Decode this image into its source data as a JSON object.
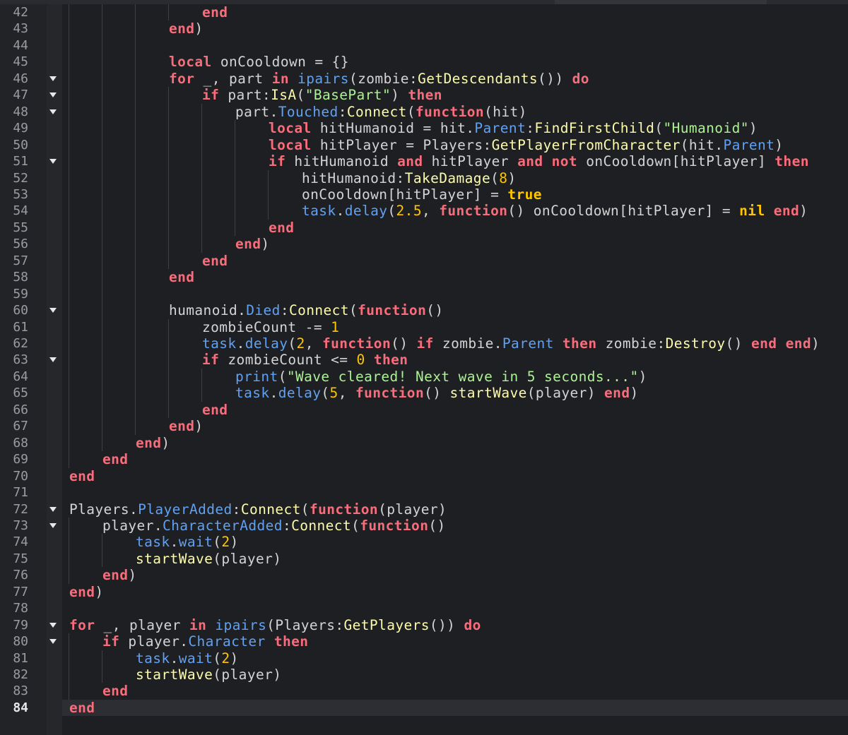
{
  "editor": {
    "current_line": 84,
    "colors": {
      "background": "#1e1f22",
      "keyword": "#f86d7c",
      "function": "#fdfbac",
      "property": "#61a1f1",
      "string": "#adf195",
      "number": "#ffc600",
      "identifier": "#d4d4d4",
      "line_number": "#9a9ca3"
    },
    "lines": [
      {
        "n": "42",
        "indent": 4,
        "fold": false,
        "tokens": [
          [
            "kw",
            "end"
          ]
        ]
      },
      {
        "n": "43",
        "indent": 3,
        "fold": false,
        "tokens": [
          [
            "kw",
            "end"
          ],
          [
            "op",
            ")"
          ]
        ]
      },
      {
        "n": "44",
        "indent": 0,
        "fold": false,
        "tokens": []
      },
      {
        "n": "45",
        "indent": 3,
        "fold": false,
        "tokens": [
          [
            "kw",
            "local"
          ],
          [
            "id",
            " onCooldown "
          ],
          [
            "op",
            "= {}"
          ]
        ]
      },
      {
        "n": "46",
        "indent": 3,
        "fold": true,
        "tokens": [
          [
            "kw",
            "for"
          ],
          [
            "id",
            " _, part "
          ],
          [
            "kw",
            "in"
          ],
          [
            "id",
            " "
          ],
          [
            "prop",
            "ipairs"
          ],
          [
            "op",
            "("
          ],
          [
            "id",
            "zombie"
          ],
          [
            "op",
            ":"
          ],
          [
            "fn",
            "GetDescendants"
          ],
          [
            "op",
            "()) "
          ],
          [
            "kw",
            "do"
          ]
        ]
      },
      {
        "n": "47",
        "indent": 4,
        "fold": true,
        "tokens": [
          [
            "kw",
            "if"
          ],
          [
            "id",
            " part"
          ],
          [
            "op",
            ":"
          ],
          [
            "fn",
            "IsA"
          ],
          [
            "op",
            "("
          ],
          [
            "str",
            "\"BasePart\""
          ],
          [
            "op",
            ") "
          ],
          [
            "kw",
            "then"
          ]
        ]
      },
      {
        "n": "48",
        "indent": 5,
        "fold": true,
        "tokens": [
          [
            "id",
            "part"
          ],
          [
            "op",
            "."
          ],
          [
            "prop",
            "Touched"
          ],
          [
            "op",
            ":"
          ],
          [
            "fn",
            "Connect"
          ],
          [
            "op",
            "("
          ],
          [
            "kw",
            "function"
          ],
          [
            "op",
            "("
          ],
          [
            "id",
            "hit"
          ],
          [
            "op",
            ")"
          ]
        ]
      },
      {
        "n": "49",
        "indent": 6,
        "fold": false,
        "tokens": [
          [
            "kw",
            "local"
          ],
          [
            "id",
            " hitHumanoid "
          ],
          [
            "op",
            "= "
          ],
          [
            "id",
            "hit"
          ],
          [
            "op",
            "."
          ],
          [
            "prop",
            "Parent"
          ],
          [
            "op",
            ":"
          ],
          [
            "fn",
            "FindFirstChild"
          ],
          [
            "op",
            "("
          ],
          [
            "str",
            "\"Humanoid\""
          ],
          [
            "op",
            ")"
          ]
        ]
      },
      {
        "n": "50",
        "indent": 6,
        "fold": false,
        "tokens": [
          [
            "kw",
            "local"
          ],
          [
            "id",
            " hitPlayer "
          ],
          [
            "op",
            "= "
          ],
          [
            "id",
            "Players"
          ],
          [
            "op",
            ":"
          ],
          [
            "fn",
            "GetPlayerFromCharacter"
          ],
          [
            "op",
            "("
          ],
          [
            "id",
            "hit"
          ],
          [
            "op",
            "."
          ],
          [
            "prop",
            "Parent"
          ],
          [
            "op",
            ")"
          ]
        ]
      },
      {
        "n": "51",
        "indent": 6,
        "fold": true,
        "tokens": [
          [
            "kw",
            "if"
          ],
          [
            "id",
            " hitHumanoid "
          ],
          [
            "kw",
            "and"
          ],
          [
            "id",
            " hitPlayer "
          ],
          [
            "kw",
            "and"
          ],
          [
            "id",
            " "
          ],
          [
            "kw",
            "not"
          ],
          [
            "id",
            " onCooldown[hitPlayer] "
          ],
          [
            "kw",
            "then"
          ]
        ]
      },
      {
        "n": "52",
        "indent": 7,
        "fold": false,
        "tokens": [
          [
            "id",
            "hitHumanoid"
          ],
          [
            "op",
            ":"
          ],
          [
            "fn",
            "TakeDamage"
          ],
          [
            "op",
            "("
          ],
          [
            "num",
            "8"
          ],
          [
            "op",
            ")"
          ]
        ]
      },
      {
        "n": "53",
        "indent": 7,
        "fold": false,
        "tokens": [
          [
            "id",
            "onCooldown[hitPlayer] "
          ],
          [
            "op",
            "= "
          ],
          [
            "bool",
            "true"
          ]
        ]
      },
      {
        "n": "54",
        "indent": 7,
        "fold": false,
        "tokens": [
          [
            "prop",
            "task"
          ],
          [
            "op",
            "."
          ],
          [
            "prop",
            "delay"
          ],
          [
            "op",
            "("
          ],
          [
            "num",
            "2.5"
          ],
          [
            "op",
            ", "
          ],
          [
            "kw",
            "function"
          ],
          [
            "op",
            "() "
          ],
          [
            "id",
            "onCooldown[hitPlayer] "
          ],
          [
            "op",
            "= "
          ],
          [
            "bool",
            "nil"
          ],
          [
            "id",
            " "
          ],
          [
            "kw",
            "end"
          ],
          [
            "op",
            ")"
          ]
        ]
      },
      {
        "n": "55",
        "indent": 6,
        "fold": false,
        "tokens": [
          [
            "kw",
            "end"
          ]
        ]
      },
      {
        "n": "56",
        "indent": 5,
        "fold": false,
        "tokens": [
          [
            "kw",
            "end"
          ],
          [
            "op",
            ")"
          ]
        ]
      },
      {
        "n": "57",
        "indent": 4,
        "fold": false,
        "tokens": [
          [
            "kw",
            "end"
          ]
        ]
      },
      {
        "n": "58",
        "indent": 3,
        "fold": false,
        "tokens": [
          [
            "kw",
            "end"
          ]
        ]
      },
      {
        "n": "59",
        "indent": 0,
        "fold": false,
        "tokens": []
      },
      {
        "n": "60",
        "indent": 3,
        "fold": true,
        "tokens": [
          [
            "id",
            "humanoid"
          ],
          [
            "op",
            "."
          ],
          [
            "prop",
            "Died"
          ],
          [
            "op",
            ":"
          ],
          [
            "fn",
            "Connect"
          ],
          [
            "op",
            "("
          ],
          [
            "kw",
            "function"
          ],
          [
            "op",
            "()"
          ]
        ]
      },
      {
        "n": "61",
        "indent": 4,
        "fold": false,
        "tokens": [
          [
            "id",
            "zombieCount "
          ],
          [
            "op",
            "-= "
          ],
          [
            "num",
            "1"
          ]
        ]
      },
      {
        "n": "62",
        "indent": 4,
        "fold": false,
        "tokens": [
          [
            "prop",
            "task"
          ],
          [
            "op",
            "."
          ],
          [
            "prop",
            "delay"
          ],
          [
            "op",
            "("
          ],
          [
            "num",
            "2"
          ],
          [
            "op",
            ", "
          ],
          [
            "kw",
            "function"
          ],
          [
            "op",
            "() "
          ],
          [
            "kw",
            "if"
          ],
          [
            "id",
            " zombie"
          ],
          [
            "op",
            "."
          ],
          [
            "prop",
            "Parent"
          ],
          [
            "id",
            " "
          ],
          [
            "kw",
            "then"
          ],
          [
            "id",
            " zombie"
          ],
          [
            "op",
            ":"
          ],
          [
            "fn",
            "Destroy"
          ],
          [
            "op",
            "() "
          ],
          [
            "kw",
            "end"
          ],
          [
            "id",
            " "
          ],
          [
            "kw",
            "end"
          ],
          [
            "op",
            ")"
          ]
        ]
      },
      {
        "n": "63",
        "indent": 4,
        "fold": true,
        "tokens": [
          [
            "kw",
            "if"
          ],
          [
            "id",
            " zombieCount "
          ],
          [
            "op",
            "<= "
          ],
          [
            "num",
            "0"
          ],
          [
            "id",
            " "
          ],
          [
            "kw",
            "then"
          ]
        ]
      },
      {
        "n": "64",
        "indent": 5,
        "fold": false,
        "tokens": [
          [
            "prop",
            "print"
          ],
          [
            "op",
            "("
          ],
          [
            "str",
            "\"Wave cleared! Next wave in 5 seconds...\""
          ],
          [
            "op",
            ")"
          ]
        ]
      },
      {
        "n": "65",
        "indent": 5,
        "fold": false,
        "tokens": [
          [
            "prop",
            "task"
          ],
          [
            "op",
            "."
          ],
          [
            "prop",
            "delay"
          ],
          [
            "op",
            "("
          ],
          [
            "num",
            "5"
          ],
          [
            "op",
            ", "
          ],
          [
            "kw",
            "function"
          ],
          [
            "op",
            "() "
          ],
          [
            "fn",
            "startWave"
          ],
          [
            "op",
            "("
          ],
          [
            "id",
            "player"
          ],
          [
            "op",
            ") "
          ],
          [
            "kw",
            "end"
          ],
          [
            "op",
            ")"
          ]
        ]
      },
      {
        "n": "66",
        "indent": 4,
        "fold": false,
        "tokens": [
          [
            "kw",
            "end"
          ]
        ]
      },
      {
        "n": "67",
        "indent": 3,
        "fold": false,
        "tokens": [
          [
            "kw",
            "end"
          ],
          [
            "op",
            ")"
          ]
        ]
      },
      {
        "n": "68",
        "indent": 2,
        "fold": false,
        "tokens": [
          [
            "kw",
            "end"
          ],
          [
            "op",
            ")"
          ]
        ]
      },
      {
        "n": "69",
        "indent": 1,
        "fold": false,
        "tokens": [
          [
            "kw",
            "end"
          ]
        ]
      },
      {
        "n": "70",
        "indent": 0,
        "fold": false,
        "tokens": [
          [
            "kw",
            "end"
          ]
        ]
      },
      {
        "n": "71",
        "indent": 0,
        "fold": false,
        "tokens": []
      },
      {
        "n": "72",
        "indent": 0,
        "fold": true,
        "tokens": [
          [
            "id",
            "Players"
          ],
          [
            "op",
            "."
          ],
          [
            "prop",
            "PlayerAdded"
          ],
          [
            "op",
            ":"
          ],
          [
            "fn",
            "Connect"
          ],
          [
            "op",
            "("
          ],
          [
            "kw",
            "function"
          ],
          [
            "op",
            "("
          ],
          [
            "id",
            "player"
          ],
          [
            "op",
            ")"
          ]
        ]
      },
      {
        "n": "73",
        "indent": 1,
        "fold": true,
        "tokens": [
          [
            "id",
            "player"
          ],
          [
            "op",
            "."
          ],
          [
            "prop",
            "CharacterAdded"
          ],
          [
            "op",
            ":"
          ],
          [
            "fn",
            "Connect"
          ],
          [
            "op",
            "("
          ],
          [
            "kw",
            "function"
          ],
          [
            "op",
            "()"
          ]
        ]
      },
      {
        "n": "74",
        "indent": 2,
        "fold": false,
        "tokens": [
          [
            "prop",
            "task"
          ],
          [
            "op",
            "."
          ],
          [
            "prop",
            "wait"
          ],
          [
            "op",
            "("
          ],
          [
            "num",
            "2"
          ],
          [
            "op",
            ")"
          ]
        ]
      },
      {
        "n": "75",
        "indent": 2,
        "fold": false,
        "tokens": [
          [
            "fn",
            "startWave"
          ],
          [
            "op",
            "("
          ],
          [
            "id",
            "player"
          ],
          [
            "op",
            ")"
          ]
        ]
      },
      {
        "n": "76",
        "indent": 1,
        "fold": false,
        "tokens": [
          [
            "kw",
            "end"
          ],
          [
            "op",
            ")"
          ]
        ]
      },
      {
        "n": "77",
        "indent": 0,
        "fold": false,
        "tokens": [
          [
            "kw",
            "end"
          ],
          [
            "op",
            ")"
          ]
        ]
      },
      {
        "n": "78",
        "indent": 0,
        "fold": false,
        "tokens": []
      },
      {
        "n": "79",
        "indent": 0,
        "fold": true,
        "tokens": [
          [
            "kw",
            "for"
          ],
          [
            "id",
            " _, player "
          ],
          [
            "kw",
            "in"
          ],
          [
            "id",
            " "
          ],
          [
            "prop",
            "ipairs"
          ],
          [
            "op",
            "("
          ],
          [
            "id",
            "Players"
          ],
          [
            "op",
            ":"
          ],
          [
            "fn",
            "GetPlayers"
          ],
          [
            "op",
            "()) "
          ],
          [
            "kw",
            "do"
          ]
        ]
      },
      {
        "n": "80",
        "indent": 1,
        "fold": true,
        "tokens": [
          [
            "kw",
            "if"
          ],
          [
            "id",
            " player"
          ],
          [
            "op",
            "."
          ],
          [
            "prop",
            "Character"
          ],
          [
            "id",
            " "
          ],
          [
            "kw",
            "then"
          ]
        ]
      },
      {
        "n": "81",
        "indent": 2,
        "fold": false,
        "tokens": [
          [
            "prop",
            "task"
          ],
          [
            "op",
            "."
          ],
          [
            "prop",
            "wait"
          ],
          [
            "op",
            "("
          ],
          [
            "num",
            "2"
          ],
          [
            "op",
            ")"
          ]
        ]
      },
      {
        "n": "82",
        "indent": 2,
        "fold": false,
        "tokens": [
          [
            "fn",
            "startWave"
          ],
          [
            "op",
            "("
          ],
          [
            "id",
            "player"
          ],
          [
            "op",
            ")"
          ]
        ]
      },
      {
        "n": "83",
        "indent": 1,
        "fold": false,
        "tokens": [
          [
            "kw",
            "end"
          ]
        ]
      },
      {
        "n": "84",
        "indent": 0,
        "fold": false,
        "tokens": [
          [
            "kw",
            "end"
          ]
        ]
      }
    ]
  }
}
